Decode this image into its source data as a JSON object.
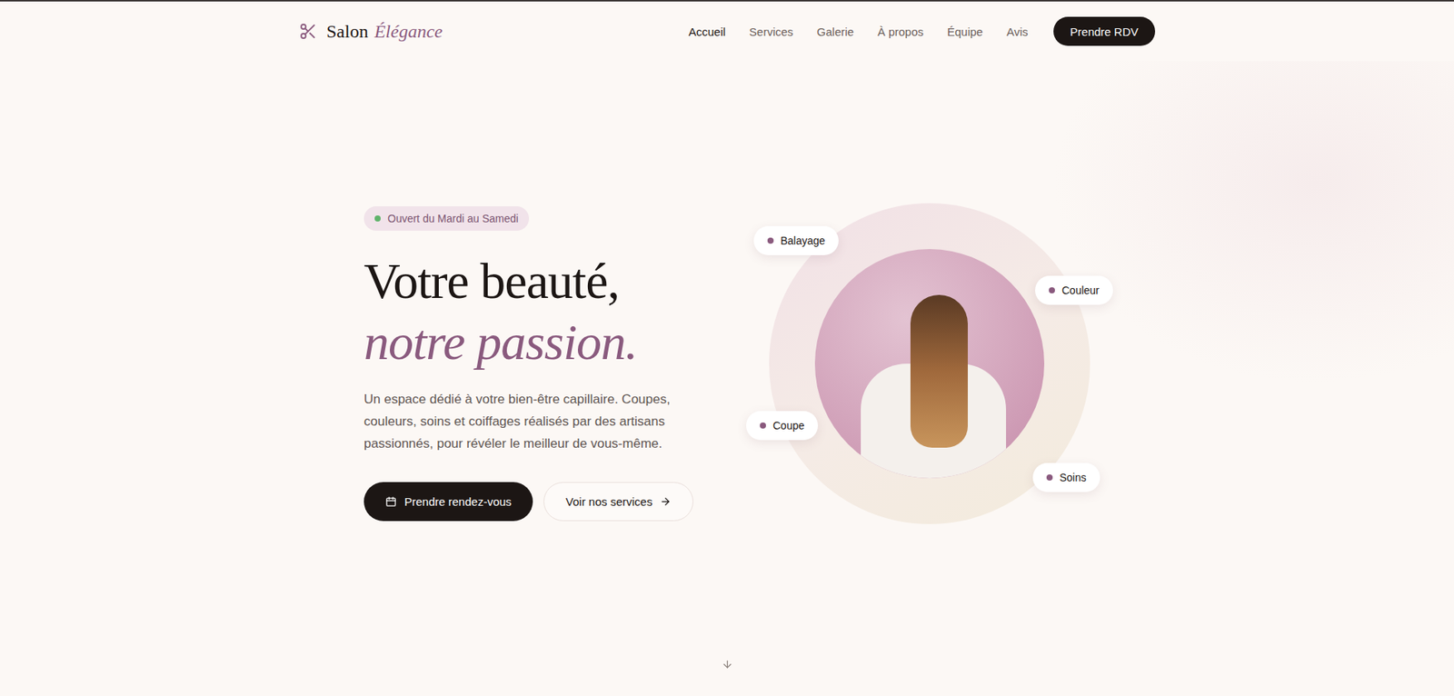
{
  "logo": {
    "name": "Salon",
    "accent": "Élégance"
  },
  "nav": {
    "items": [
      {
        "label": "Accueil",
        "selected": true
      },
      {
        "label": "Services",
        "selected": false
      },
      {
        "label": "Galerie",
        "selected": false
      },
      {
        "label": "À propos",
        "selected": false
      },
      {
        "label": "Équipe",
        "selected": false
      },
      {
        "label": "Avis",
        "selected": false
      }
    ],
    "cta": "Prendre RDV"
  },
  "hero": {
    "badge": "Ouvert du Mardi au Samedi",
    "open": true,
    "title": "Votre beauté,",
    "title_accent": "notre passion.",
    "text": "Un espace dédié à votre bien-être capillaire. Coupes, couleurs, soins et coiffages réalisés par des artisans passionnés, pour révéler le meilleur de vous-même.",
    "primary": "Prendre rendez-vous",
    "secondary": "Voir nos services"
  },
  "tags": [
    "Balayage",
    "Couleur",
    "Coupe",
    "Soins"
  ]
}
